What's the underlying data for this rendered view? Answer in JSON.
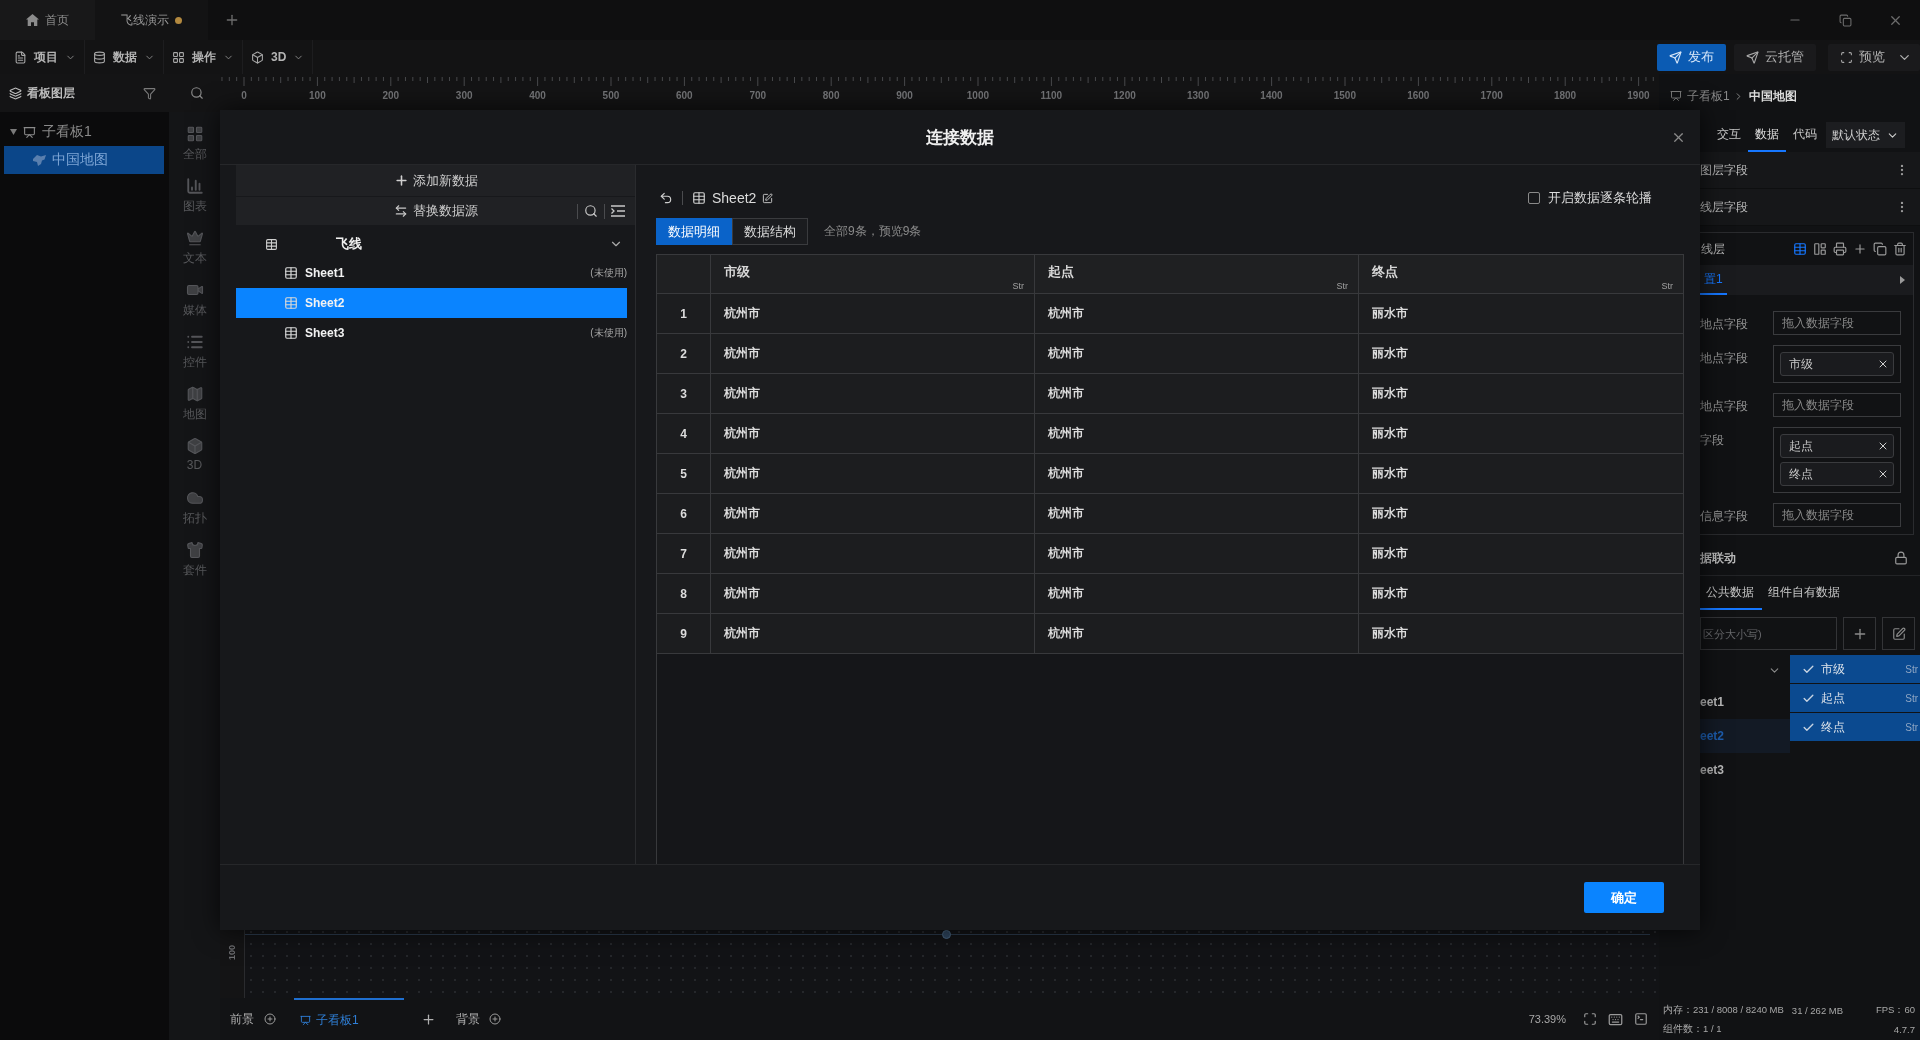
{
  "title_bar": {
    "tabs": [
      {
        "label": "首页",
        "kind": "home",
        "selected": false,
        "unsaved": false
      },
      {
        "label": "飞线演示",
        "kind": "project",
        "selected": true,
        "unsaved": true
      }
    ]
  },
  "toolbar": {
    "menus": [
      {
        "label": "项目"
      },
      {
        "label": "数据"
      },
      {
        "label": "操作"
      },
      {
        "label": "3D"
      }
    ],
    "actions": [
      {
        "label": "发布",
        "kind": "primary"
      },
      {
        "label": "云托管",
        "kind": "plain"
      },
      {
        "label": "预览",
        "kind": "dropdown"
      }
    ]
  },
  "layers_panel": {
    "title": "看板图层",
    "tree": [
      {
        "label": "子看板1",
        "selected": false,
        "expanded": true,
        "children": [
          {
            "label": "中国地图",
            "selected": true
          }
        ]
      }
    ]
  },
  "component_bar": [
    {
      "label": "全部"
    },
    {
      "label": "图表"
    },
    {
      "label": "文本"
    },
    {
      "label": "媒体"
    },
    {
      "label": "控件"
    },
    {
      "label": "地图"
    },
    {
      "label": "3D"
    },
    {
      "label": "拓扑"
    },
    {
      "label": "套件"
    }
  ],
  "ruler": {
    "labels": [
      "0",
      "100",
      "200",
      "300",
      "400",
      "500",
      "600",
      "700",
      "800",
      "900",
      "1000",
      "1100",
      "1200",
      "1300",
      "1400",
      "1500",
      "1600",
      "1700",
      "1800",
      "1900"
    ],
    "vertical_labels": [
      "100"
    ]
  },
  "dialog": {
    "title": "连接数据",
    "sources": {
      "add": "添加新数据",
      "replace": "替换数据源",
      "groups": [
        {
          "label": "飞线",
          "expanded": true,
          "children": [
            {
              "label": "Sheet1",
              "note": "(未使用)",
              "selected": false
            },
            {
              "label": "Sheet2",
              "selected": true
            },
            {
              "label": "Sheet3",
              "note": "(未使用)",
              "selected": false
            }
          ]
        }
      ]
    },
    "sheet_title": "Sheet2",
    "carousel": {
      "label": "开启数据逐条轮播",
      "checked": false
    },
    "tabs": [
      {
        "label": "数据明细",
        "selected": true
      },
      {
        "label": "数据结构",
        "selected": false
      }
    ],
    "summary": "全部9条，预览9条",
    "table": {
      "columns": [
        {
          "label": "市级",
          "type": "Str"
        },
        {
          "label": "起点",
          "type": "Str"
        },
        {
          "label": "终点",
          "type": "Str"
        }
      ],
      "rows": [
        {
          "index": "1",
          "cells": [
            "杭州市",
            "杭州市",
            "丽水市"
          ]
        },
        {
          "index": "2",
          "cells": [
            "杭州市",
            "杭州市",
            "丽水市"
          ]
        },
        {
          "index": "3",
          "cells": [
            "杭州市",
            "杭州市",
            "丽水市"
          ]
        },
        {
          "index": "4",
          "cells": [
            "杭州市",
            "杭州市",
            "丽水市"
          ]
        },
        {
          "index": "5",
          "cells": [
            "杭州市",
            "杭州市",
            "丽水市"
          ]
        },
        {
          "index": "6",
          "cells": [
            "杭州市",
            "杭州市",
            "丽水市"
          ]
        },
        {
          "index": "7",
          "cells": [
            "杭州市",
            "杭州市",
            "丽水市"
          ]
        },
        {
          "index": "8",
          "cells": [
            "杭州市",
            "杭州市",
            "丽水市"
          ]
        },
        {
          "index": "9",
          "cells": [
            "杭州市",
            "杭州市",
            "丽水市"
          ]
        }
      ]
    },
    "confirm": "确定"
  },
  "inspector": {
    "breadcrumb": [
      "子看板1",
      "中国地图"
    ],
    "tabs": [
      {
        "label": "交互",
        "selected": false
      },
      {
        "label": "数据",
        "selected": true
      },
      {
        "label": "代码",
        "selected": false
      }
    ],
    "state_select": "默认状态",
    "sections": [
      {
        "title": "图层字段"
      },
      {
        "title": "线层字段"
      }
    ],
    "layer": {
      "title": "线层",
      "config_tabs": [
        {
          "label": "置1",
          "selected": true
        }
      ],
      "fields": [
        {
          "label": "地点字段",
          "kind": "drop",
          "placeholder": "拖入数据字段"
        },
        {
          "label": "地点字段",
          "kind": "tags",
          "tags": [
            "市级"
          ]
        },
        {
          "label": "地点字段",
          "kind": "drop",
          "placeholder": "拖入数据字段"
        },
        {
          "label": "字段",
          "kind": "tags",
          "tags": [
            "起点",
            "终点"
          ]
        },
        {
          "label": "信息字段",
          "kind": "drop",
          "placeholder": "拖入数据字段"
        }
      ]
    },
    "linkage": {
      "title": "据联动",
      "locked": true
    },
    "data_tabs": [
      {
        "label": "公共数据",
        "selected": true
      },
      {
        "label": "组件自有数据",
        "selected": false
      }
    ],
    "search": {
      "placeholder": "区分大小写)"
    },
    "sheets": [
      {
        "label": "eet1",
        "selected": false
      },
      {
        "label": "eet2",
        "selected": true
      },
      {
        "label": "eet3",
        "selected": false
      }
    ],
    "field_menu": [
      {
        "label": "市级",
        "type": "Str",
        "checked": true
      },
      {
        "label": "起点",
        "type": "Str",
        "checked": true
      },
      {
        "label": "终点",
        "type": "Str",
        "checked": true
      }
    ]
  },
  "bottom_bar": {
    "foreground": "前景",
    "boards": [
      {
        "label": "子看板1",
        "selected": true
      }
    ],
    "background": "背景",
    "zoom": "73.39%"
  },
  "status": {
    "memory": "内存：231 / 8008 / 8240 MB",
    "gpu_memory": "31 / 262 MB",
    "fps": "FPS：60",
    "components": "组件数：1 / 1",
    "version": "4.7.7"
  }
}
